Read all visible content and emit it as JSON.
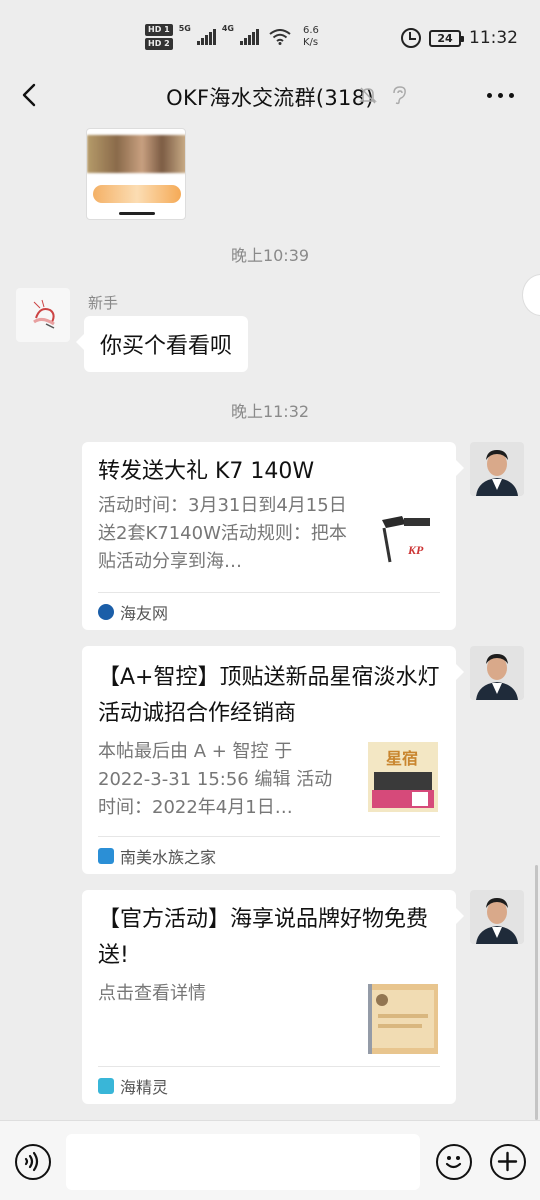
{
  "status_bar": {
    "hd1": "HD 1",
    "hd2": "HD 2",
    "net1": "5G",
    "net2": "4G",
    "speed_value": "6.6",
    "speed_unit": "K/s",
    "battery": "24",
    "time": "11:32"
  },
  "header": {
    "title": "OKF海水交流群(318)",
    "back_icon": "chevron-left-icon",
    "mute_icon": "bell-off-icon",
    "ear_icon": "ear-icon",
    "more_icon": "more-horizontal-icon"
  },
  "chat": {
    "time1": "晚上10:39",
    "message1": {
      "sender": "新手",
      "text": "你买个看看呗"
    },
    "time2": "晚上11:32",
    "cards": [
      {
        "title": "转发送大礼 K7 140W",
        "desc": "活动时间：3月31日到4月15日送2套K7140W活动规则：把本贴活动分享到海…",
        "source": "海友网",
        "source_color": "#1b5ea8"
      },
      {
        "title": "【A+智控】顶贴送新品星宿淡水灯活动诚招合作经销商",
        "desc": " 本帖最后由 A + 智控 于 2022-3-31 15:56 编辑 活动时间：2022年4月1日…",
        "source": "南美水族之家",
        "source_color": "#2b8fd6",
        "thumb_label": "星宿"
      },
      {
        "title": "【官方活动】海享说品牌好物免费送!",
        "desc": "点击查看详情",
        "source": "海精灵",
        "source_color": "#39b6d8"
      }
    ]
  },
  "input_bar": {
    "voice_icon": "voice-icon",
    "emoji_icon": "emoji-icon",
    "plus_icon": "plus-circle-icon",
    "input_value": ""
  }
}
